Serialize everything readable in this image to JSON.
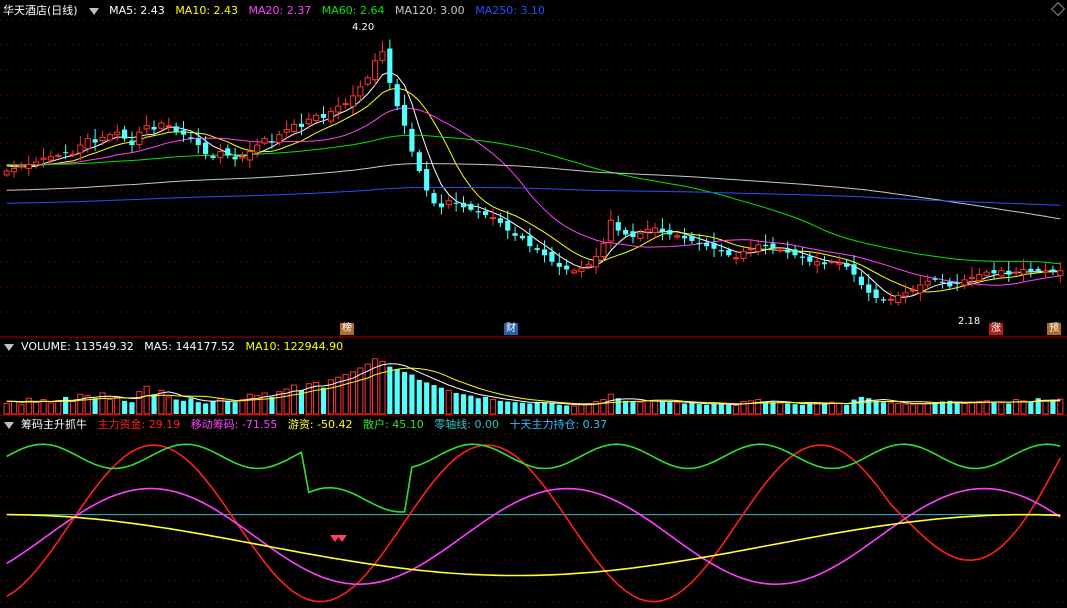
{
  "colors": {
    "up": "#ff3232",
    "down": "#54ffff",
    "ma5": "#ffffff",
    "ma10": "#ffff00",
    "ma20": "#ff40ff",
    "ma60": "#00e600",
    "ma120": "#c8c8c8",
    "ma250": "#2050ff",
    "main_fund": "#ff2020",
    "move_chip": "#ff40ff",
    "hot_money": "#ffff30",
    "retail": "#30e030",
    "zero_axis": "#30c0c0",
    "dotted": "#ff40ff"
  },
  "price_header": {
    "title": "华天酒店(日线)",
    "ma5": "MA5: 2.43",
    "ma10": "MA10: 2.43",
    "ma20": "MA20: 2.37",
    "ma60": "MA60: 2.64",
    "ma120": "MA120: 3.00",
    "ma250": "MA250: 3.10"
  },
  "volume_header": {
    "title": "VOLUME: 113549.32",
    "ma5": "MA5: 144177.52",
    "ma10": "MA10: 122944.90"
  },
  "indicator_header": {
    "title": "筹码主升抓牛",
    "main_fund": "主力资金: 29.19",
    "move_chip": "移动筹码: -71.55",
    "hot_money": "游资: -50.42",
    "retail": "散户: 45.10",
    "zero_axis": "零轴线: 0.00",
    "ten_day": "十天主力持仓: 0.37"
  },
  "markers": {
    "bang": "榜",
    "cai": "财",
    "zhang": "涨",
    "yu": "预"
  },
  "chart_data": [
    {
      "type": "candlestick",
      "title": "华天酒店(日线)",
      "annotations": [
        "4.20",
        "2.18"
      ],
      "high_value": 4.2,
      "low_value": 2.18,
      "ylim": [
        2.05,
        4.35
      ],
      "n_bars": 144,
      "ma_series": [
        {
          "name": "MA5",
          "last": 2.43
        },
        {
          "name": "MA10",
          "last": 2.43
        },
        {
          "name": "MA20",
          "last": 2.37
        },
        {
          "name": "MA60",
          "last": 2.64
        },
        {
          "name": "MA120",
          "last": 3.0
        },
        {
          "name": "MA250",
          "last": 3.1
        }
      ],
      "close": [
        3.2,
        3.22,
        3.24,
        3.25,
        3.27,
        3.3,
        3.31,
        3.32,
        3.34,
        3.33,
        3.4,
        3.45,
        3.42,
        3.46,
        3.48,
        3.5,
        3.45,
        3.4,
        3.5,
        3.55,
        3.52,
        3.57,
        3.55,
        3.5,
        3.48,
        3.45,
        3.4,
        3.33,
        3.3,
        3.35,
        3.32,
        3.29,
        3.31,
        3.35,
        3.4,
        3.45,
        3.42,
        3.48,
        3.52,
        3.56,
        3.54,
        3.6,
        3.63,
        3.61,
        3.66,
        3.7,
        3.72,
        3.78,
        3.85,
        3.92,
        4.05,
        4.12,
        3.88,
        3.7,
        3.55,
        3.35,
        3.2,
        3.05,
        2.95,
        2.92,
        2.97,
        2.95,
        2.92,
        2.9,
        2.88,
        2.86,
        2.84,
        2.8,
        2.74,
        2.7,
        2.68,
        2.62,
        2.59,
        2.55,
        2.5,
        2.46,
        2.44,
        2.43,
        2.45,
        2.48,
        2.54,
        2.64,
        2.82,
        2.74,
        2.71,
        2.69,
        2.72,
        2.75,
        2.76,
        2.73,
        2.71,
        2.7,
        2.68,
        2.66,
        2.64,
        2.62,
        2.6,
        2.58,
        2.55,
        2.53,
        2.58,
        2.6,
        2.63,
        2.62,
        2.6,
        2.59,
        2.57,
        2.55,
        2.53,
        2.5,
        2.5,
        2.48,
        2.5,
        2.49,
        2.46,
        2.4,
        2.32,
        2.26,
        2.22,
        2.2,
        2.21,
        2.24,
        2.26,
        2.28,
        2.32,
        2.35,
        2.36,
        2.34,
        2.31,
        2.33,
        2.36,
        2.38,
        2.4,
        2.42,
        2.41,
        2.43,
        2.4,
        2.42,
        2.44,
        2.42,
        2.43,
        2.43,
        2.42,
        2.43
      ],
      "ylabel": ""
    },
    {
      "type": "bar",
      "title": "VOLUME: 113549.32",
      "series": [
        {
          "name": "MA5",
          "last": 144177.52
        },
        {
          "name": "MA10",
          "last": 122944.9
        }
      ],
      "values": [
        80,
        95,
        70,
        120,
        90,
        110,
        85,
        100,
        130,
        95,
        150,
        140,
        120,
        160,
        110,
        130,
        100,
        90,
        170,
        210,
        150,
        180,
        130,
        110,
        100,
        120,
        90,
        80,
        95,
        120,
        100,
        90,
        110,
        150,
        140,
        160,
        130,
        170,
        190,
        220,
        180,
        230,
        240,
        200,
        260,
        280,
        300,
        320,
        350,
        380,
        420,
        400,
        360,
        340,
        320,
        300,
        260,
        240,
        220,
        200,
        180,
        160,
        150,
        140,
        120,
        130,
        110,
        100,
        95,
        90,
        85,
        80,
        90,
        85,
        80,
        70,
        65,
        60,
        75,
        80,
        95,
        110,
        150,
        120,
        100,
        95,
        90,
        100,
        105,
        95,
        90,
        85,
        80,
        85,
        75,
        70,
        80,
        75,
        70,
        65,
        95,
        100,
        110,
        95,
        90,
        85,
        80,
        75,
        70,
        80,
        85,
        75,
        90,
        80,
        70,
        110,
        130,
        120,
        100,
        90,
        85,
        80,
        75,
        70,
        80,
        85,
        90,
        95,
        100,
        85,
        80,
        90,
        95,
        100,
        90,
        85,
        80,
        110,
        100,
        90,
        120,
        100,
        110,
        113
      ]
    },
    {
      "type": "line",
      "title": "筹码主升抓牛",
      "ylim": [
        -100,
        100
      ],
      "series": [
        {
          "name": "主力资金",
          "last": 29.19
        },
        {
          "name": "移动筹码",
          "last": -71.55
        },
        {
          "name": "游资",
          "last": -50.42
        },
        {
          "name": "散户",
          "last": 45.1
        },
        {
          "name": "零轴线",
          "last": 0.0
        },
        {
          "name": "十天主力持仓",
          "last": 0.37
        }
      ]
    }
  ]
}
